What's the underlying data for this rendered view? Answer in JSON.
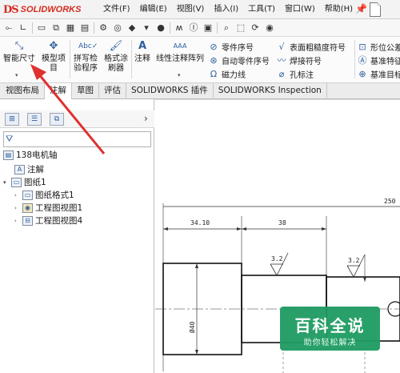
{
  "app": {
    "logo_ds": "DS",
    "logo_name": "SOLIDWORKS"
  },
  "menu": [
    "文件(F)",
    "编辑(E)",
    "视图(V)",
    "插入(I)",
    "工具(T)",
    "窗口(W)",
    "帮助(H)"
  ],
  "ribbon": {
    "smart_dimension": "智能尺寸",
    "model_items_1": "模型项",
    "model_items_2": "目",
    "spell_check_1": "拼写检",
    "spell_check_2": "验程序",
    "format_painter_1": "格式涂",
    "format_painter_2": "刷器",
    "note": "注释",
    "linear_pattern": "线性注释阵列",
    "balloon": "零件序号",
    "auto_balloon": "自动零件序号",
    "magnetic_line": "磁力线",
    "surface_finish": "表面粗糙度符号",
    "weld_symbol": "焊接符号",
    "hole_callout": "孔标注",
    "gtol": "形位公差",
    "datum_feature": "基准特征",
    "datum_target": "基准目标"
  },
  "tabs": [
    "视图布局",
    "注解",
    "草图",
    "评估",
    "SOLIDWORKS 插件",
    "SOLIDWORKS Inspection"
  ],
  "active_tab": "注解",
  "tree": {
    "root": "138电机轴",
    "annotations": "注解",
    "sheet": "图纸1",
    "sheet_format": "图纸格式1",
    "view1": "工程图视图1",
    "view4": "工程图视图4"
  },
  "drawing": {
    "dim_250": "250",
    "dim_3410": "34.10",
    "dim_38": "38",
    "rough1": "3.2",
    "rough2": "3.2",
    "dia": "Ø40"
  },
  "watermark": {
    "main": "百科全说",
    "sub": "助你轻松解决"
  },
  "colors": {
    "accent": "#2b5e9c",
    "logo": "#d42b1e",
    "arrow": "#e03030",
    "watermark": "#1e9b62"
  }
}
